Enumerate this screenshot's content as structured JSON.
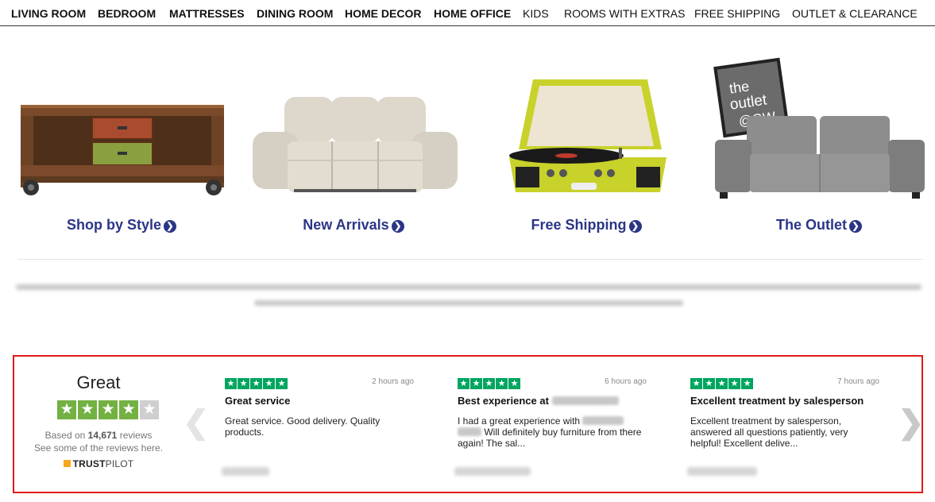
{
  "nav": {
    "items": [
      {
        "label": "LIVING ROOM"
      },
      {
        "label": "BEDROOM"
      },
      {
        "label": "MATTRESSES"
      },
      {
        "label": "DINING ROOM"
      },
      {
        "label": "HOME DECOR"
      },
      {
        "label": "HOME OFFICE"
      },
      {
        "label": "KIDS"
      },
      {
        "label": "ROOMS WITH EXTRAS"
      },
      {
        "label": "FREE SHIPPING"
      },
      {
        "label": "OUTLET & CLEARANCE"
      }
    ]
  },
  "categories": [
    {
      "label": "Shop by Style",
      "icon": "chevron-circle-right-icon"
    },
    {
      "label": "New Arrivals",
      "icon": "chevron-circle-right-icon"
    },
    {
      "label": "Free Shipping",
      "icon": "chevron-circle-right-icon"
    },
    {
      "label": "The Outlet",
      "icon": "chevron-circle-right-icon"
    }
  ],
  "outlet_badge": {
    "line1": "the",
    "line2": "outlet",
    "line3": "@GW"
  },
  "trustpilot": {
    "rating_word": "Great",
    "rating_stars": 4,
    "based_prefix": "Based on ",
    "review_count": "14,671",
    "based_suffix": " reviews",
    "see_some": "See some of the reviews here.",
    "brand_bold": "TRUST",
    "brand_light": "PILOT",
    "star_color": "#73b143",
    "review_star_color": "#00a560"
  },
  "reviews": [
    {
      "time": "2 hours ago",
      "title": "Great service",
      "body": "Great service. Good delivery. Quality products."
    },
    {
      "time": "6 hours ago",
      "title": "Best experience at",
      "body_a": "I had a great experience with",
      "body_b": "Will definitely buy furniture from there again! The sal..."
    },
    {
      "time": "7 hours ago",
      "title": "Excellent treatment by salesperson",
      "body": "Excellent treatment by salesperson, answered all questions patiently, very helpful! Excellent delive..."
    }
  ],
  "accent_color": "#2b3586",
  "highlight_color": "#e01a1a"
}
